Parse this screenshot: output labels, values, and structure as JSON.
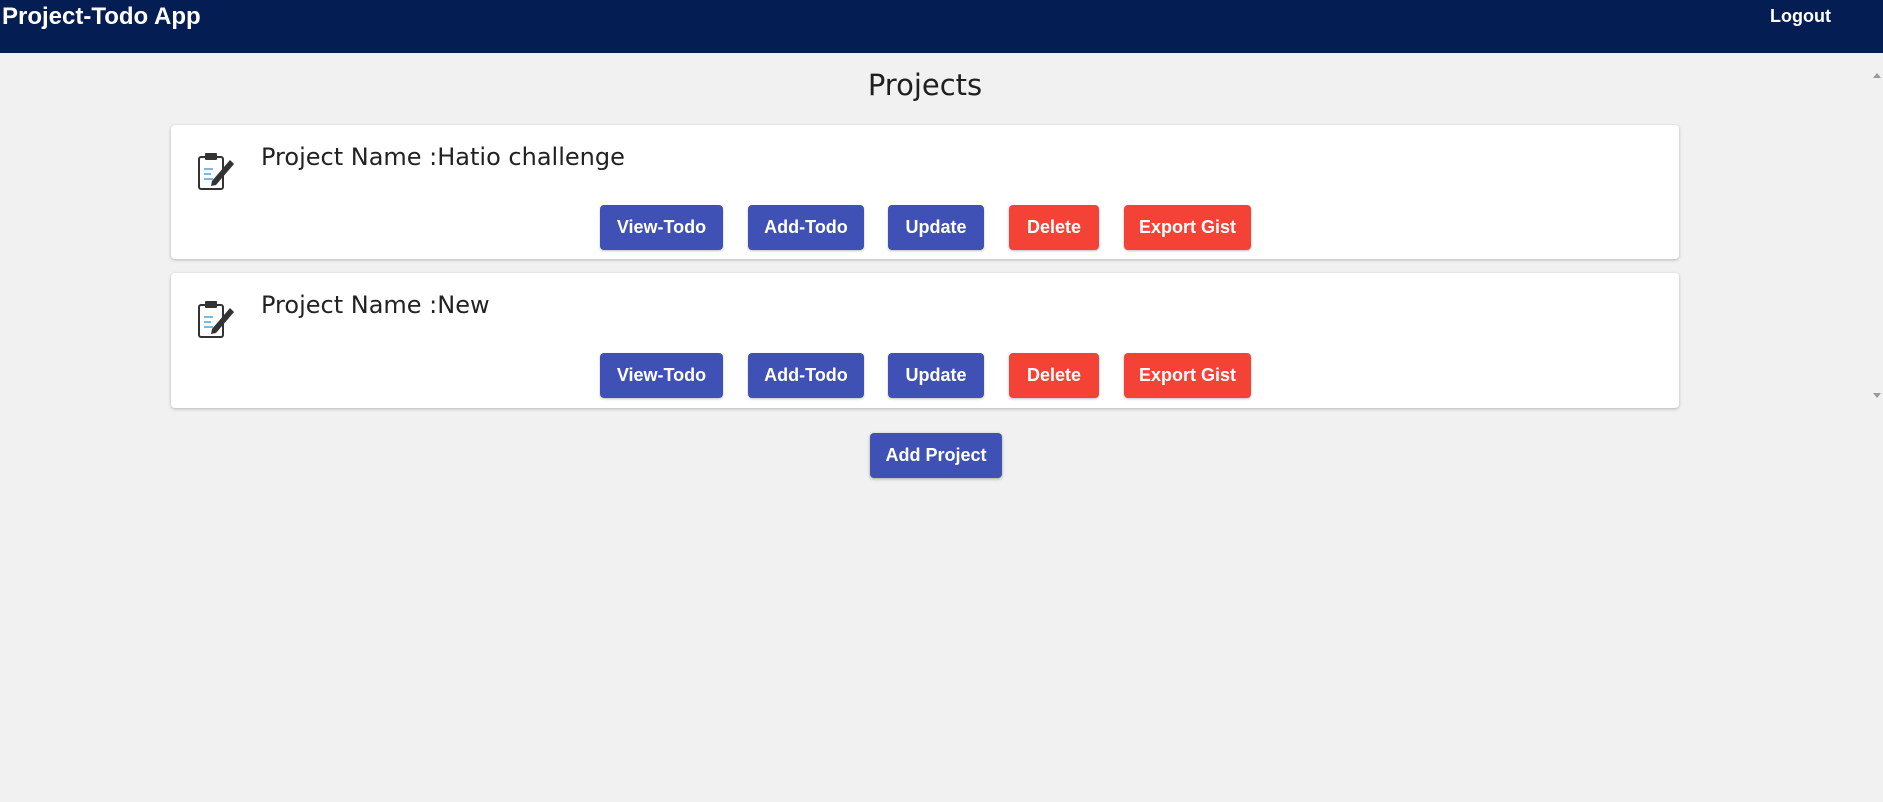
{
  "header": {
    "app_title": "Project-Todo App",
    "logout_label": "Logout"
  },
  "main": {
    "title": "Projects",
    "projects": [
      {
        "name": "Project Name :Hatio challenge",
        "buttons": {
          "view": "View-Todo",
          "add": "Add-Todo",
          "update": "Update",
          "delete": "Delete",
          "export": "Export Gist"
        }
      },
      {
        "name": "Project Name :New",
        "buttons": {
          "view": "View-Todo",
          "add": "Add-Todo",
          "update": "Update",
          "delete": "Delete",
          "export": "Export Gist"
        }
      }
    ],
    "add_project_label": "Add Project"
  },
  "icons": {
    "project": "clipboard-edit-icon",
    "scroll_up": "scroll-up-arrow-icon",
    "scroll_down": "scroll-down-arrow-icon"
  },
  "colors": {
    "navbar": "#041d52",
    "primary": "#3f51b5",
    "danger": "#f44336",
    "background": "#f1f1f1"
  }
}
